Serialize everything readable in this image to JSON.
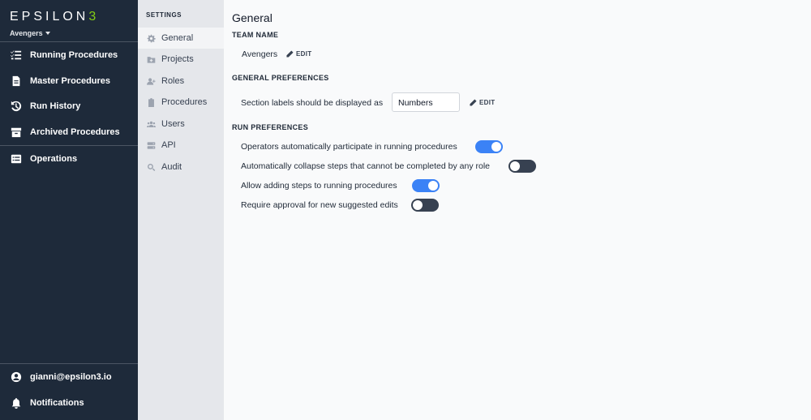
{
  "brand": {
    "logo_main": "EPSILON",
    "logo_accent": "3",
    "team": "Avengers"
  },
  "nav": {
    "items": [
      {
        "label": "Running Procedures",
        "icon": "list-check-icon"
      },
      {
        "label": "Master Procedures",
        "icon": "document-icon"
      },
      {
        "label": "Run History",
        "icon": "history-icon"
      },
      {
        "label": "Archived Procedures",
        "icon": "archive-icon"
      }
    ],
    "operations": {
      "label": "Operations",
      "icon": "list-icon"
    },
    "user": {
      "label": "gianni@epsilon3.io",
      "icon": "user-circle-icon"
    },
    "notifications": {
      "label": "Notifications",
      "icon": "bell-icon"
    }
  },
  "settings": {
    "heading": "SETTINGS",
    "items": [
      {
        "label": "General",
        "icon": "gear-icon",
        "active": true
      },
      {
        "label": "Projects",
        "icon": "folder-plus-icon"
      },
      {
        "label": "Roles",
        "icon": "user-plus-icon"
      },
      {
        "label": "Procedures",
        "icon": "clipboard-icon"
      },
      {
        "label": "Users",
        "icon": "users-icon"
      },
      {
        "label": "API",
        "icon": "server-icon"
      },
      {
        "label": "Audit",
        "icon": "search-icon"
      }
    ]
  },
  "main": {
    "title": "General",
    "team_name": {
      "heading": "TEAM NAME",
      "value": "Avengers",
      "edit": "EDIT"
    },
    "general_prefs": {
      "heading": "GENERAL PREFERENCES",
      "label": "Section labels should be displayed as",
      "value": "Numbers",
      "edit": "EDIT"
    },
    "run_prefs": {
      "heading": "RUN PREFERENCES",
      "items": [
        {
          "label": "Operators automatically participate in running procedures",
          "on": true
        },
        {
          "label": "Automatically collapse steps that cannot be completed by any role",
          "on": false
        },
        {
          "label": "Allow adding steps to running procedures",
          "on": true
        },
        {
          "label": "Require approval for new suggested edits",
          "on": false
        }
      ]
    }
  },
  "colors": {
    "sidebar": "#1e2a3a",
    "toggle_on": "#3b82f6",
    "toggle_off": "#374151",
    "accent": "#84cc16"
  }
}
